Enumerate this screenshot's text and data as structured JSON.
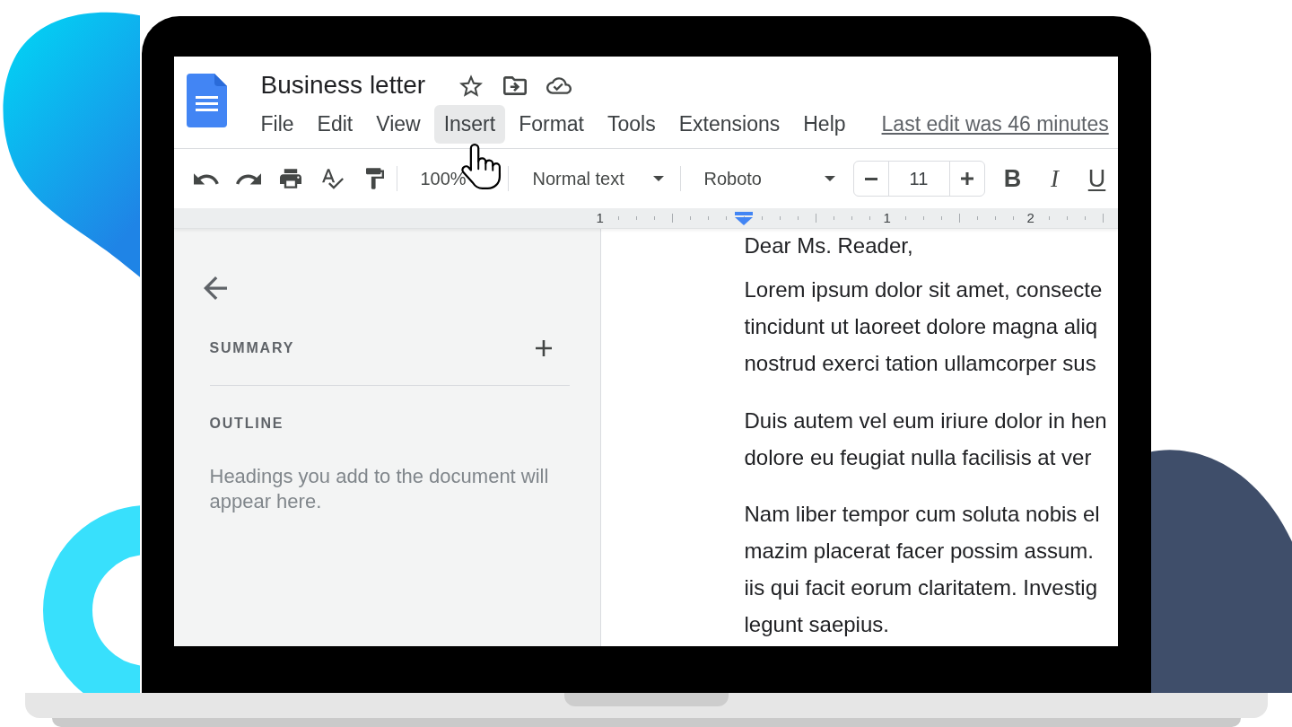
{
  "document": {
    "title": "Business letter"
  },
  "menu": {
    "items": [
      {
        "label": "File",
        "highlighted": false
      },
      {
        "label": "Edit",
        "highlighted": false
      },
      {
        "label": "View",
        "highlighted": false
      },
      {
        "label": "Insert",
        "highlighted": true
      },
      {
        "label": "Format",
        "highlighted": false
      },
      {
        "label": "Tools",
        "highlighted": false
      },
      {
        "label": "Extensions",
        "highlighted": false
      },
      {
        "label": "Help",
        "highlighted": false
      }
    ],
    "last_edit": "Last edit was 46 minutes"
  },
  "toolbar": {
    "zoom": "100%",
    "paragraph_style": "Normal text",
    "font": "Roboto",
    "font_size": "11",
    "format_buttons": [
      {
        "kind": "bold",
        "label": "B"
      },
      {
        "kind": "italic",
        "label": "I"
      },
      {
        "kind": "underline",
        "label": "U"
      }
    ]
  },
  "ruler": {
    "stops": [
      {
        "kind": "number",
        "label": "1"
      },
      {
        "kind": "indent_marker"
      },
      {
        "kind": "number",
        "label": "1"
      },
      {
        "kind": "number",
        "label": "2"
      }
    ]
  },
  "outline_panel": {
    "summary_heading": "SUMMARY",
    "outline_heading": "OUTLINE",
    "empty_message": "Headings you add to the document will appear here."
  },
  "page": {
    "paragraphs": [
      {
        "lines": [
          "Dear Ms. Reader,"
        ]
      },
      {
        "lines": [
          "Lorem ipsum dolor sit amet, consecte",
          "tincidunt ut laoreet dolore magna aliq",
          "nostrud exerci tation ullamcorper sus"
        ]
      },
      {
        "lines": [
          "Duis autem vel eum iriure dolor in hen",
          "dolore eu feugiat nulla facilisis at ver"
        ]
      },
      {
        "lines": [
          "Nam liber tempor cum soluta nobis el",
          "mazim placerat facer possim assum.",
          "iis qui facit eorum claritatem. Investig",
          "legunt saepius."
        ]
      }
    ]
  }
}
